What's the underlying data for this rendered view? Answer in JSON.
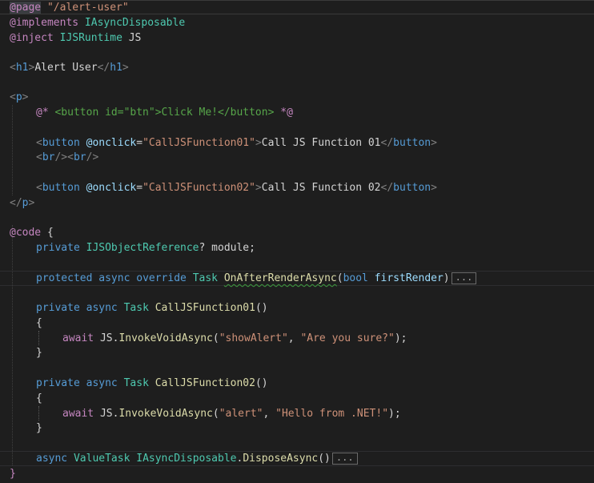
{
  "lines": {
    "l1": {
      "a": "@page",
      "b": " ",
      "c": "\"/alert-user\""
    },
    "l2": {
      "a": "@implements",
      "b": " ",
      "c": "IAsyncDisposable"
    },
    "l3": {
      "a": "@inject",
      "b": " ",
      "c": "IJSRuntime",
      "d": " JS"
    },
    "l5": {
      "a": "<",
      "b": "h1",
      "c": ">",
      "d": "Alert User",
      "e": "</",
      "f": "h1",
      "g": ">"
    },
    "l7": {
      "a": "<",
      "b": "p",
      "c": ">"
    },
    "l8": {
      "a": "@*",
      "b": " <button id=\"btn\">Click Me!</button> ",
      "c": "*@"
    },
    "l10": {
      "a": "<",
      "b": "button",
      "c": " ",
      "d": "@onclick",
      "e": "=",
      "f": "\"CallJSFunction01\"",
      "g": ">",
      "h": "Call JS Function 01",
      "i": "</",
      "j": "button",
      "k": ">"
    },
    "l11": {
      "a": "<",
      "b": "br",
      "c": "/><",
      "d": "br",
      "e": "/>"
    },
    "l13": {
      "a": "<",
      "b": "button",
      "c": " ",
      "d": "@onclick",
      "e": "=",
      "f": "\"CallJSFunction02\"",
      "g": ">",
      "h": "Call JS Function 02",
      "i": "</",
      "j": "button",
      "k": ">"
    },
    "l14": {
      "a": "</",
      "b": "p",
      "c": ">"
    },
    "l16": {
      "a": "@code",
      "b": " {"
    },
    "l17": {
      "a": "private",
      "b": " ",
      "c": "IJSObjectReference",
      "d": "? module;"
    },
    "l19": {
      "a": "protected",
      "b": " ",
      "c": "async",
      "d": " ",
      "e": "override",
      "f": " ",
      "g": "Task",
      "h": " ",
      "i": "OnAfterRenderAsync",
      "j": "(",
      "k": "bool",
      "l": " ",
      "m": "firstRender",
      "n": ")",
      "fold": "..."
    },
    "l21": {
      "a": "private",
      "b": " ",
      "c": "async",
      "d": " ",
      "e": "Task",
      "f": " ",
      "g": "CallJSFunction01",
      "h": "()"
    },
    "l22": {
      "a": "{"
    },
    "l23": {
      "a": "await",
      "b": " JS.",
      "c": "InvokeVoidAsync",
      "d": "(",
      "e": "\"showAlert\"",
      "f": ", ",
      "g": "\"Are you sure?\"",
      "h": ");"
    },
    "l24": {
      "a": "}"
    },
    "l26": {
      "a": "private",
      "b": " ",
      "c": "async",
      "d": " ",
      "e": "Task",
      "f": " ",
      "g": "CallJSFunction02",
      "h": "()"
    },
    "l27": {
      "a": "{"
    },
    "l28": {
      "a": "await",
      "b": " JS.",
      "c": "InvokeVoidAsync",
      "d": "(",
      "e": "\"alert\"",
      "f": ", ",
      "g": "\"Hello from .NET!\"",
      "h": ");"
    },
    "l29": {
      "a": "}"
    },
    "l31": {
      "a": "async",
      "b": " ",
      "c": "ValueTask",
      "d": " ",
      "e": "IAsyncDisposable",
      "f": ".",
      "g": "DisposeAsync",
      "h": "()",
      "fold": "..."
    },
    "l32": {
      "a": "}"
    }
  }
}
